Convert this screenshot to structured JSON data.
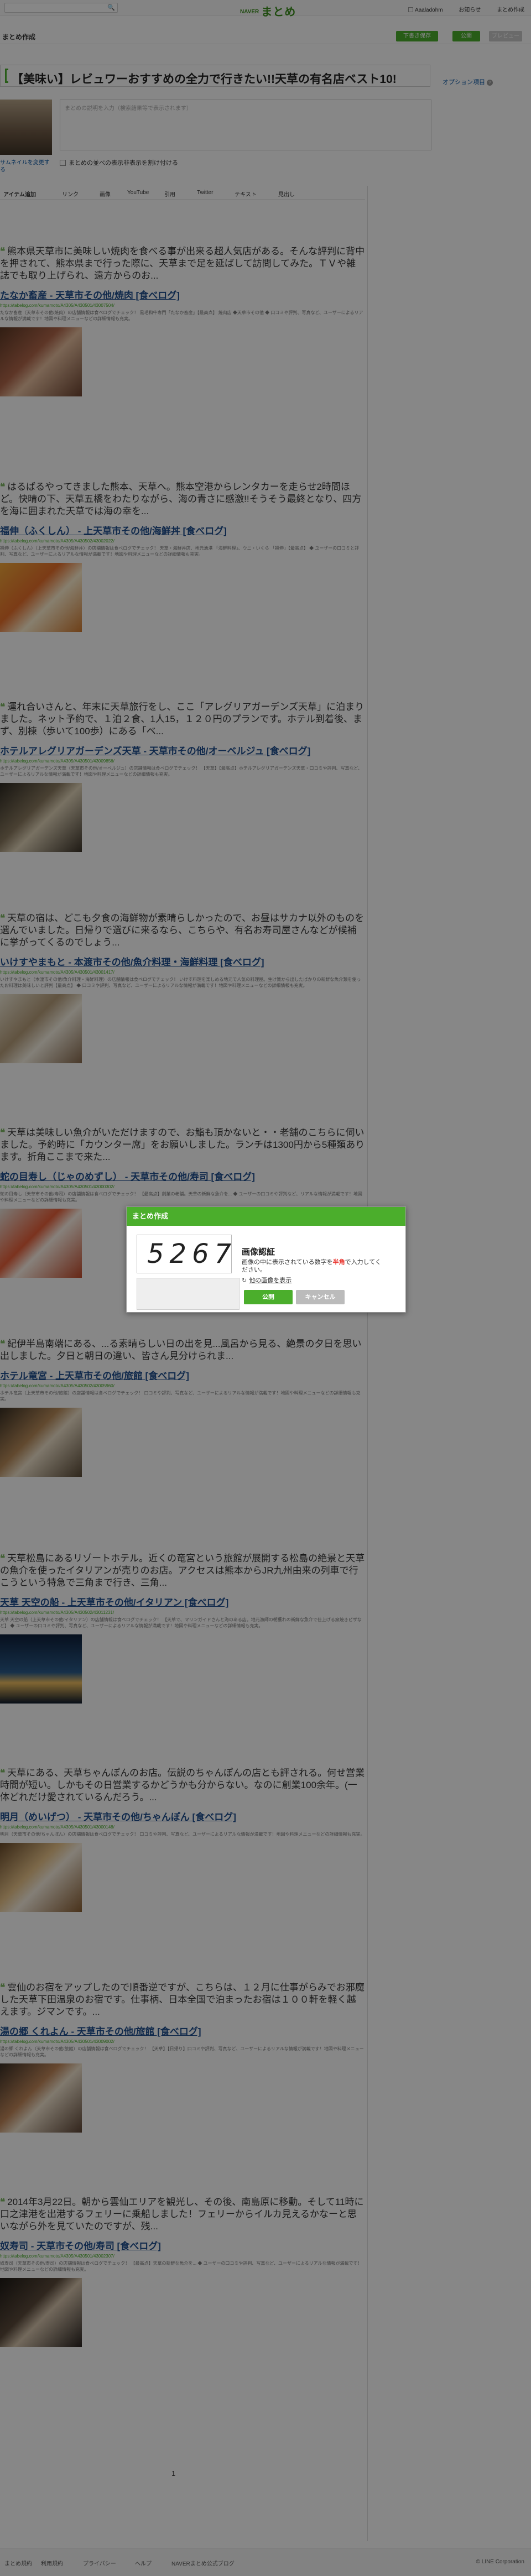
{
  "header": {
    "logo_word": "まとめ",
    "brand": "NAVER",
    "links": [
      "Aaaladohm",
      "お知らせ",
      "まとめ作成"
    ]
  },
  "subbar": {
    "title": "まとめ作成",
    "buttons": [
      "下書き保存",
      "公開",
      "プレビュー"
    ]
  },
  "matome": {
    "title": "【美味い】レビュワーおすすめの全力で行きたい!!天草の有名店ベスト10!",
    "option_link": "オプション項目",
    "thumbnail_change": "サムネイルを変更する",
    "description_placeholder": "まとめの説明を入力（検索結果等で表示されます）",
    "private_checkbox": "まとめの並べの表示非表示を割け付ける"
  },
  "tabs": [
    "アイテム追加",
    "リンク",
    "画像",
    "YouTube",
    "引用",
    "Twitter",
    "テキスト",
    "見出し"
  ],
  "entries": [
    {
      "quote": "熊本県天草市に美味しい焼肉を食べる事が出来る超人気店がある。そんな評判に背中を押されて、熊本県まで行った際に、天草まで足を延ばして訪問してみた。ＴＶや雑誌でも取り上げられ、遠方からのお...",
      "title": "たなか畜産 - 天草市その他/焼肉 [食べログ]",
      "url": "https://tabelog.com/kumamoto/A4305/A430501/43007504/",
      "snippet": "たなか畜産（天草市その他/焼肉）の店舗情報は食べログでチェック！ 黒毛和牛専門「たなか畜産」【最高点】 焼肉店 ◆天草市その他 ◆ 口コミや評判、写真など、ユーザーによるリアルな情報が満載です！地図や料理メニューなどの詳細情報も充実。"
    },
    {
      "quote": "はるばるやってきました熊本、天草へ。熊本空港からレンタカーを走らせ2時間ほど。快晴の下、天草五橋をわたりながら、海の青さに感激!!そうそう最終となり、四方を海に囲まれた天草では海の幸を...",
      "title": "福伸（ふくしん） - 上天草市その他/海鮮丼 [食べログ]",
      "url": "https://tabelog.com/kumamoto/A4305/A430502/43002022/",
      "snippet": "福伸（ふくしん）（上天草市その他/海鮮丼）の店舗情報は食べログでチェック！ 天草・海鮮丼店、地元漁港 「海鮮料理」、ウニ・いくら 「福伸」【最高点】 ◆ ユーザーの口コミと評判、写真など、ユーザーによるリアルな情報が満載です！地図や料理メニューなどの詳細情報も充実。"
    },
    {
      "quote": "運れ合いさんと、年末に天草旅行をし、ここ「アレグリアガーデンズ天草」に泊まりました。ネット予約で、１泊２食、1人15，１２０円のプランです。ホテル到着後、まず、別棟（歩いて100歩）にある「ベ...",
      "title": "ホテルアレグリアガーデンズ天草 - 天草市その他/オーベルジュ [食べログ]",
      "url": "https://tabelog.com/kumamoto/A4305/A430501/43009856/",
      "snippet": "ホテルアレグリアガーデンズ天草（天草市その他/オーベルジュ）の店舗情報は食べログでチェック！ 【天草】【最高点】ホテルアレグリアガーデンズ天草・口コミや評判、写真など、ユーザーによるリアルな情報が満載です！地図や料理メニューなどの詳細情報も充実。"
    },
    {
      "quote": "天草の宿は、どこも夕食の海鮮物が素晴らしかったので、お昼はサカナ以外のものを選んでいました。日帰りで選びに来るなら、こちらや、有名お寿司屋さんなどが候補に挙がってくるのでしょう...",
      "title": "いけすやまもと - 本渡市その他/魚介料理・海鮮料理 [食べログ]",
      "url": "https://tabelog.com/kumamoto/A4305/A430501/43001417/",
      "snippet": "いけすやまもと（本渡市その他/魚介料理・海鮮料理）の店舗情報は食べログでチェック！ いけす料理を楽しめる地元で人気の料理屋。生け簀から出したばかりの新鮮な魚介類を使ったお料理は美味しいと評判【最高点】 ◆ 口コミや評判、写真など、ユーザーによるリアルな情報が満載です！地図や料理メニューなどの詳細情報も充実。"
    },
    {
      "quote": "天草は美味しい魚介がいただけますので、お鮨も頂かないと・・老舗のこちらに伺いました。予約時に「カウンター席」をお願いしました。ランチは1300円から5種類あります。折角ここまで来た...",
      "title": "蛇の目寿し（じゃのめずし） - 天草市その他/寿司 [食べログ]",
      "url": "https://tabelog.com/kumamoto/A4305/A430501/43000302/",
      "snippet": "蛇の目寿し（天草市その他/寿司）の店舗情報は食べログでチェック！ 【最高点】創業の老舗。天草の新鮮な魚介を... ◆ ユーザーの口コミや評判など、リアルな情報が満載です！地図や料理メニューなどの詳細情報も充実。"
    },
    {
      "quote": "紀伊半島南端にある、...る素晴らしい日の出を見...風呂から見る、絶景の夕日を思い出しました。夕日と朝日の違い、皆さん見分けられま...",
      "title": "ホテル竜宮 - 上天草市その他/旅館 [食べログ]",
      "url": "https://tabelog.com/kumamoto/A4305/A430502/43005960/",
      "snippet": "ホテル竜宮（上天草市その他/旅館）の店舗情報は食べログでチェック！ 口コミや評判、写真など、ユーザーによるリアルな情報が満載です！地図や料理メニューなどの詳細情報も充実。"
    },
    {
      "quote": "天草松島にあるリゾートホテル。近くの竜宮という旅館が展開する松島の絶景と天草の魚介を使ったイタリアンが売りのお店。アクセスは熊本からJR九州由来の列車で行こうという特急で三角まで行き、三角...",
      "title": "天草 天空の船 - 上天草市その他/イタリアン [食べログ]",
      "url": "https://tabelog.com/kumamoto/A4305/A430502/43011231/",
      "snippet": "天草 天空の船（上天草市その他/イタリアン）の店舗情報は食べログでチェック！ 【天草で、マリンガイドさんと海のある店。地元漁師の朝獲れの新鮮な魚介で仕上げる窯焼きピザなど】 ◆ ユーザーの口コミや評判、写真など、ユーザーによるリアルな情報が満載です！地図や料理メニューなどの詳細情報も充実。"
    },
    {
      "quote": "天草にある、天草ちゃんぽんのお店。伝説のちゃんぽんの店とも評される。何せ営業時間が短い。しかもその日営業するかどうかも分からない。なのに創業100余年。(一体どれだけ愛されているんだろう。...",
      "title": "明月（めいげつ） - 天草市その他/ちゃんぽん [食べログ]",
      "url": "https://tabelog.com/kumamoto/A4305/A430501/43000148/",
      "snippet": "明月（天草市その他/ちゃんぽん）の店舗情報は食べログでチェック！ 口コミや評判、写真など、ユーザーによるリアルな情報が満載です！地図や料理メニューなどの詳細情報も充実。"
    },
    {
      "quote": "雲仙のお宿をアップしたので順番逆ですが、こちらは、１２月に仕事がらみでお邪魔した天草下田温泉のお宿です。仕事柄、日本全国で泊まったお宿は１００軒を軽く越えます。ジマンです。...",
      "title": "湯の郷 くれよん - 天草市その他/旅館 [食べログ]",
      "url": "https://tabelog.com/kumamoto/A4305/A430501/43009002/",
      "snippet": "湯の郷 くれよん（天草市その他/旅館）の店舗情報は食べログでチェック！ 【天草】【日帰り】口コミや評判、写真など、ユーザーによるリアルな情報が満載です！地図や料理メニューなどの詳細情報も充実。"
    },
    {
      "quote": "2014年3月22日。朝から雲仙エリアを観光し、その後、南島原に移動。そして11時に口之津港を出港するフェリーに乗船しました！フェリーからイルカ見えるかなーと思いながら外を見ていたのですが、残...",
      "title": "奴寿司 - 天草市その他/寿司 [食べログ]",
      "url": "https://tabelog.com/kumamoto/A4305/A430501/43002307/",
      "snippet": "奴寿司（天草市その他/寿司）の店舗情報は食べログでチェック！ 【最高点】天草の新鮮な魚介を... ◆ ユーザーの口コミや評判、写真など、ユーザーによるリアルな情報が満載です！地図や料理メニューなどの詳細情報も充実。"
    }
  ],
  "pager": "1",
  "footer": {
    "links": [
      "まとめ規約",
      "利用規約",
      "プライバシー",
      "ヘルプ",
      "NAVERまとめ公式ブログ"
    ],
    "copyright": "© LINE Corporation"
  },
  "modal": {
    "header": "まとめ作成",
    "captcha_digits": "5267",
    "title": "画像認証",
    "instruction_before": "画像の中に表示されている数字を",
    "instruction_red": "半角",
    "instruction_after": "で入力してください。",
    "reload_link": "他の画像を表示",
    "ok": "公開",
    "cancel": "キャンセル"
  },
  "colors": {
    "accent": "#4bae2c",
    "link": "#1f4f8f",
    "overlay": "rgba(0,0,0,0.47)"
  }
}
